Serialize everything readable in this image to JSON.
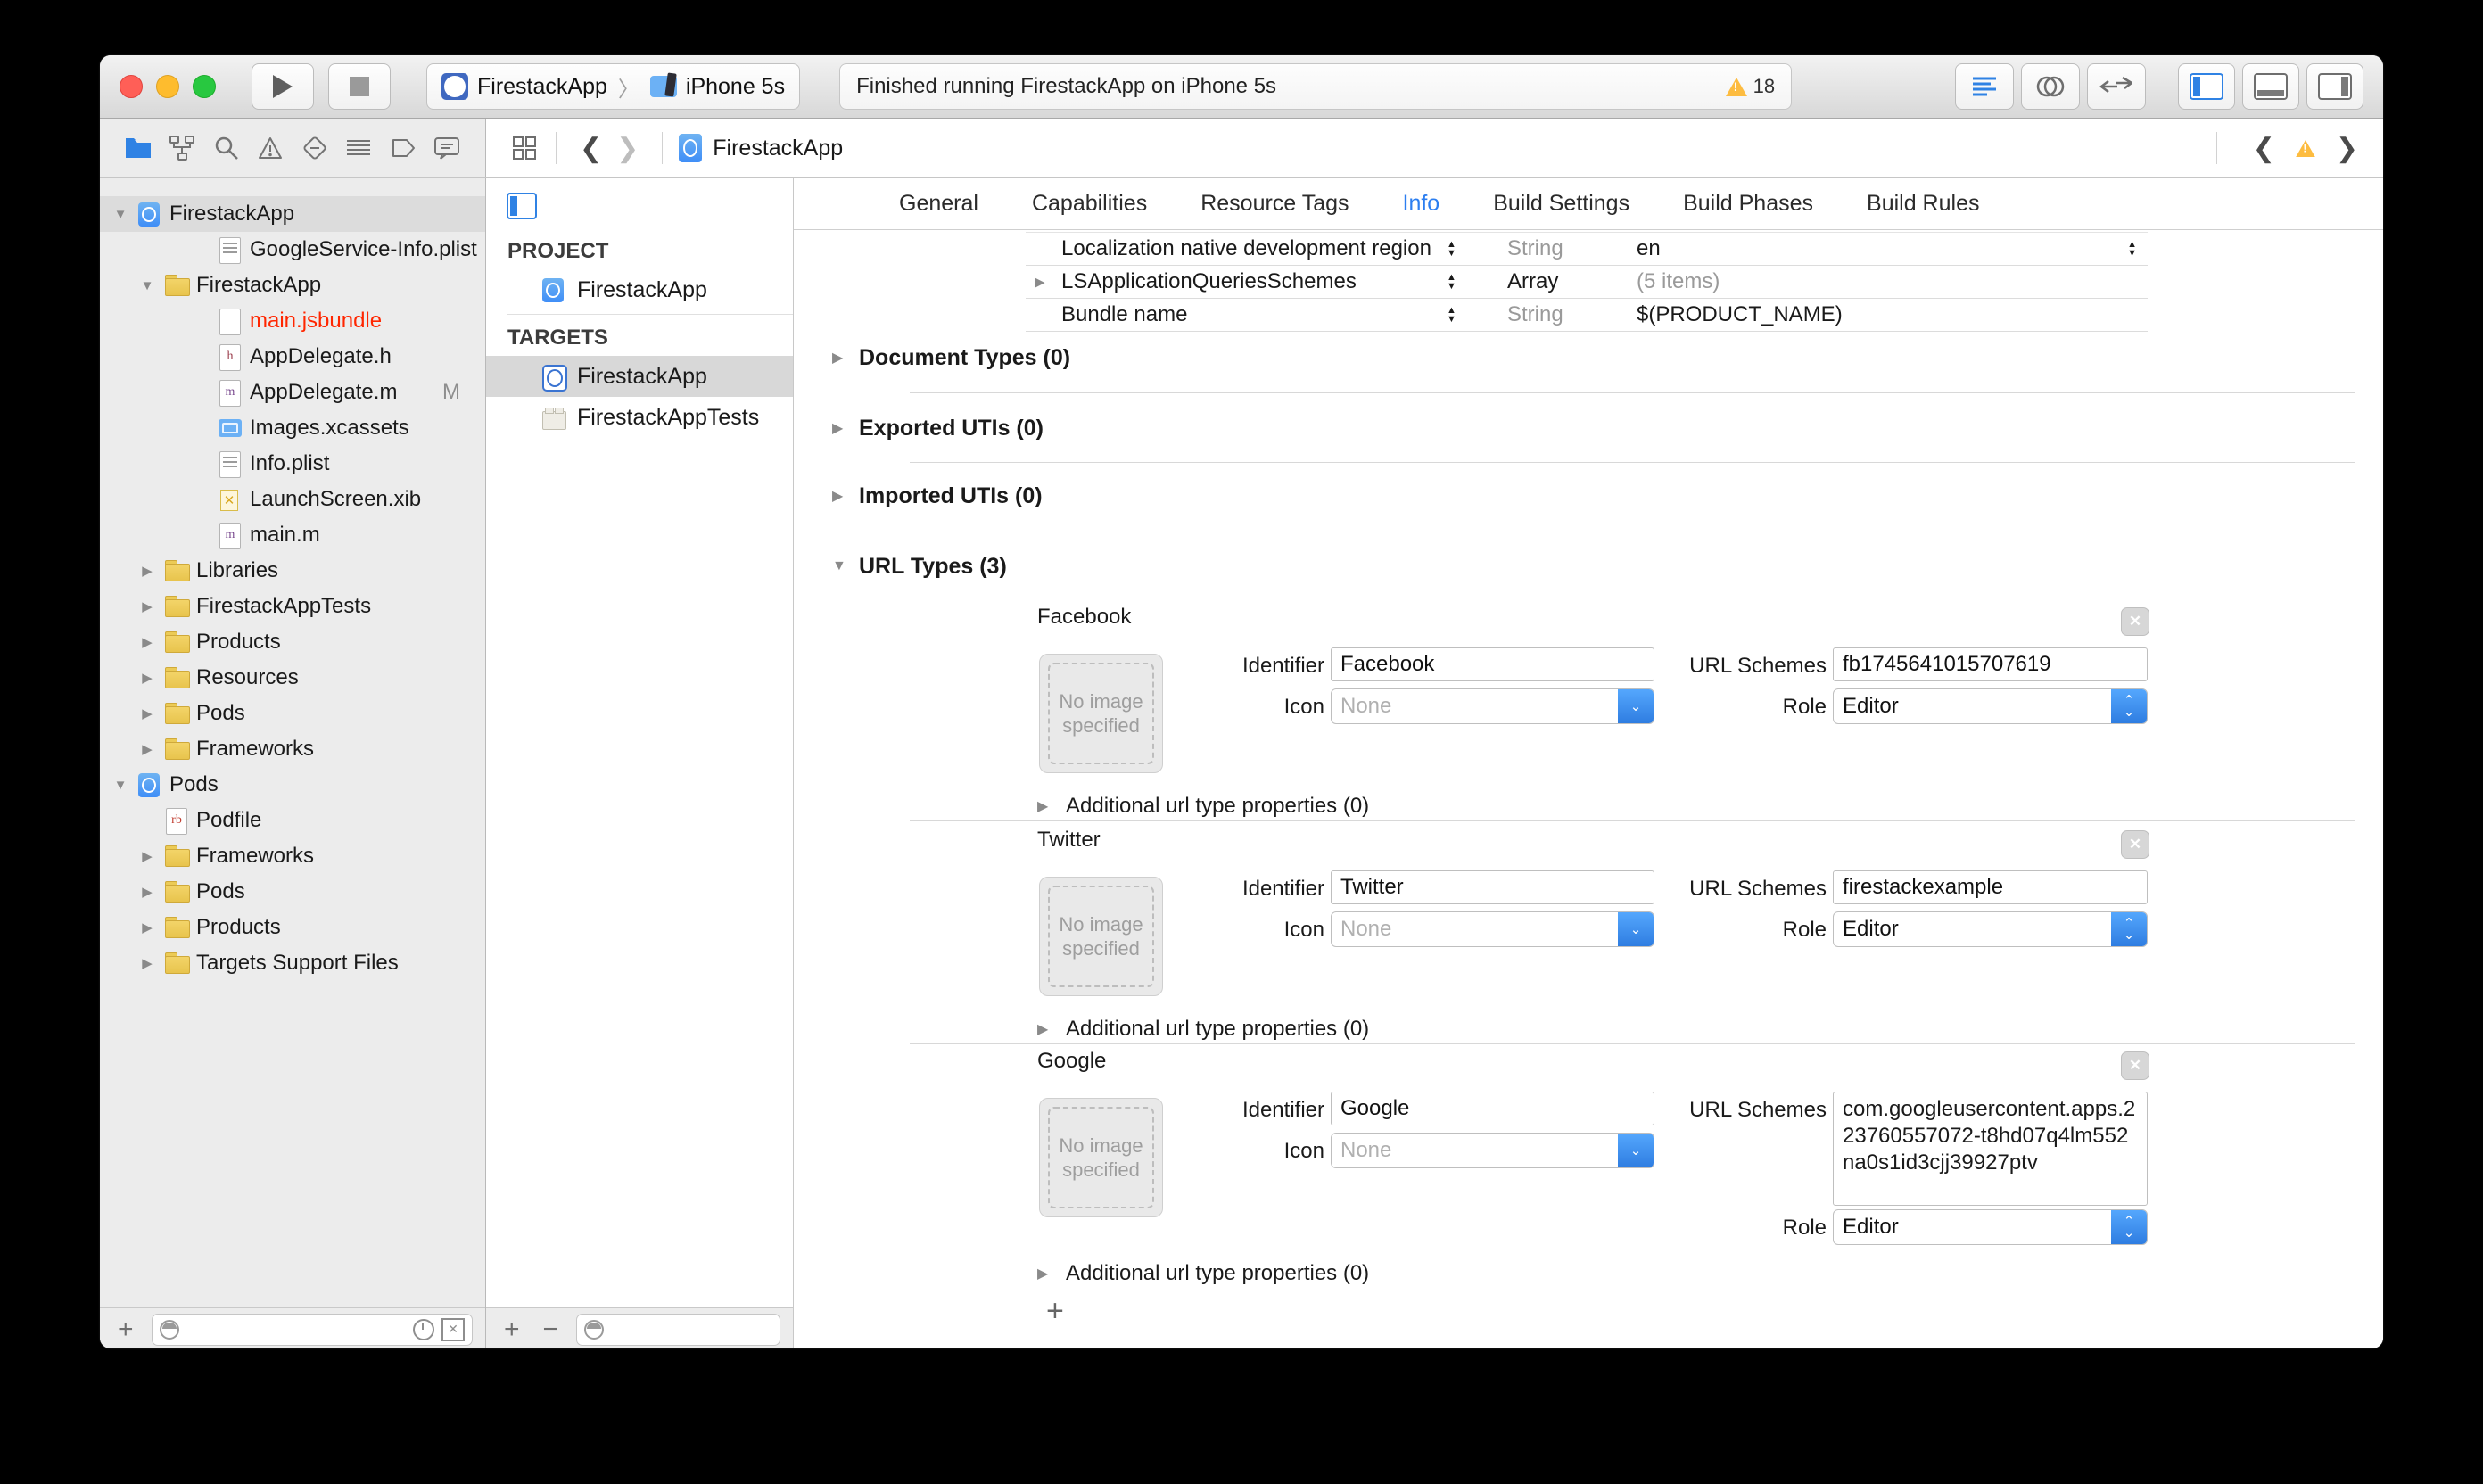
{
  "colors": {
    "accent": "#2f82e4",
    "warning_yellow": "#fdbc40",
    "missing_file_red": "#ff2600",
    "selection_gray": "#dcdcdc"
  },
  "titlebar": {
    "scheme": {
      "project": "FirestackApp",
      "separator": "〉",
      "device": "iPhone 5s"
    },
    "status": {
      "message": "Finished running FirestackApp on iPhone 5s",
      "warning_count": "18"
    },
    "editor_mode_icons": [
      "standard-editor-icon",
      "assistant-editor-icon",
      "version-editor-icon"
    ],
    "panel_toggle_icons": [
      "navigator-panel-icon",
      "debug-area-icon",
      "utilities-panel-icon"
    ]
  },
  "navrow": {
    "navigator_icons": [
      "project-navigator-icon",
      "symbol-navigator-icon",
      "search-navigator-icon",
      "issue-navigator-icon",
      "test-navigator-icon",
      "debug-navigator-icon",
      "breakpoint-navigator-icon",
      "report-navigator-icon"
    ],
    "jumpbar": {
      "back": "❮",
      "forward": "❯",
      "title": "FirestackApp"
    },
    "issue_stepper": {
      "back": "❮",
      "forward": "❯"
    }
  },
  "navigator": {
    "items": [
      {
        "label": "FirestackApp",
        "icon": "xcodeproj-icon",
        "disc": "▼",
        "level": 0,
        "state": "selected"
      },
      {
        "label": "GoogleService-Info.plist",
        "icon": "plist-icon",
        "disc": "",
        "level": 2
      },
      {
        "label": "FirestackApp",
        "icon": "folder-icon",
        "disc": "▼",
        "level": 1
      },
      {
        "label": "main.jsbundle",
        "icon": "document-icon",
        "disc": "",
        "level": 2,
        "text_state": "missing"
      },
      {
        "label": "AppDelegate.h",
        "icon": "header-file-icon",
        "disc": "",
        "level": 2
      },
      {
        "label": "AppDelegate.m",
        "icon": "impl-file-icon",
        "disc": "",
        "level": 2,
        "badge": "M"
      },
      {
        "label": "Images.xcassets",
        "icon": "xcassets-icon",
        "disc": "",
        "level": 2
      },
      {
        "label": "Info.plist",
        "icon": "plist-icon",
        "disc": "",
        "level": 2
      },
      {
        "label": "LaunchScreen.xib",
        "icon": "xib-icon",
        "disc": "",
        "level": 2
      },
      {
        "label": "main.m",
        "icon": "impl-file-icon",
        "disc": "",
        "level": 2
      },
      {
        "label": "Libraries",
        "icon": "folder-icon",
        "disc": "▶",
        "level": 1
      },
      {
        "label": "FirestackAppTests",
        "icon": "folder-icon",
        "disc": "▶",
        "level": 1
      },
      {
        "label": "Products",
        "icon": "folder-icon",
        "disc": "▶",
        "level": 1
      },
      {
        "label": "Resources",
        "icon": "folder-icon",
        "disc": "▶",
        "level": 1
      },
      {
        "label": "Pods",
        "icon": "folder-icon",
        "disc": "▶",
        "level": 1
      },
      {
        "label": "Frameworks",
        "icon": "folder-icon",
        "disc": "▶",
        "level": 1
      },
      {
        "label": "Pods",
        "icon": "xcodeproj-icon",
        "disc": "▼",
        "level": 0
      },
      {
        "label": "Podfile",
        "icon": "ruby-file-icon",
        "disc": "",
        "level": 1
      },
      {
        "label": "Frameworks",
        "icon": "folder-icon",
        "disc": "▶",
        "level": 1
      },
      {
        "label": "Pods",
        "icon": "folder-icon",
        "disc": "▶",
        "level": 1
      },
      {
        "label": "Products",
        "icon": "folder-icon",
        "disc": "▶",
        "level": 1
      },
      {
        "label": "Targets Support Files",
        "icon": "folder-icon",
        "disc": "▶",
        "level": 1
      }
    ],
    "bottom": {
      "add": "+",
      "filter_placeholder": ""
    }
  },
  "project_panel": {
    "project_header": "PROJECT",
    "project_item": {
      "label": "FirestackApp",
      "icon": "xcodeproj-icon"
    },
    "targets_header": "TARGETS",
    "targets": [
      {
        "label": "FirestackApp",
        "icon": "app-target-icon",
        "state": "selected"
      },
      {
        "label": "FirestackAppTests",
        "icon": "test-target-icon"
      }
    ],
    "bottom": {
      "add": "+",
      "remove": "−",
      "filter_placeholder": ""
    }
  },
  "editor": {
    "tabs": [
      {
        "label": "General"
      },
      {
        "label": "Capabilities"
      },
      {
        "label": "Resource Tags"
      },
      {
        "label": "Info",
        "state": "active"
      },
      {
        "label": "Build Settings"
      },
      {
        "label": "Build Phases"
      },
      {
        "label": "Build Rules"
      }
    ],
    "plist_rows": [
      {
        "key": "Localization native development region",
        "disc": "",
        "type": "String",
        "value": "en",
        "has_right_stepper": true
      },
      {
        "key": "LSApplicationQueriesSchemes",
        "disc": "▶",
        "type": "Array",
        "type_state": "black",
        "value": "(5 items)",
        "value_state": "muted"
      },
      {
        "key": "Bundle name",
        "disc": "",
        "type": "String",
        "value": "$(PRODUCT_NAME)"
      }
    ],
    "sections": [
      {
        "disc": "▶",
        "title": "Document Types (0)"
      },
      {
        "disc": "▶",
        "title": "Exported UTIs (0)"
      },
      {
        "disc": "▶",
        "title": "Imported UTIs (0)"
      },
      {
        "disc": "▼",
        "title": "URL Types (3)"
      }
    ],
    "labels": {
      "identifier": "Identifier",
      "icon": "Icon",
      "icon_none": "None",
      "url_schemes": "URL Schemes",
      "role": "Role",
      "no_image": "No image specified",
      "additional": "Additional url type properties (0)",
      "close": "✕",
      "add_url_type": "+"
    },
    "url_types": [
      {
        "name": "Facebook",
        "identifier": "Facebook",
        "schemes": "fb1745641015707619",
        "role": "Editor",
        "additional_disc": "▶"
      },
      {
        "name": "Twitter",
        "identifier": "Twitter",
        "schemes": "firestackexample",
        "role": "Editor",
        "additional_disc": "▶"
      },
      {
        "name": "Google",
        "identifier": "Google",
        "schemes": "com.googleusercontent.apps.223760557072-t8hd07q4lm552na0s1id3cjj39927ptv",
        "role": "Editor",
        "additional_disc": "▶"
      }
    ]
  }
}
